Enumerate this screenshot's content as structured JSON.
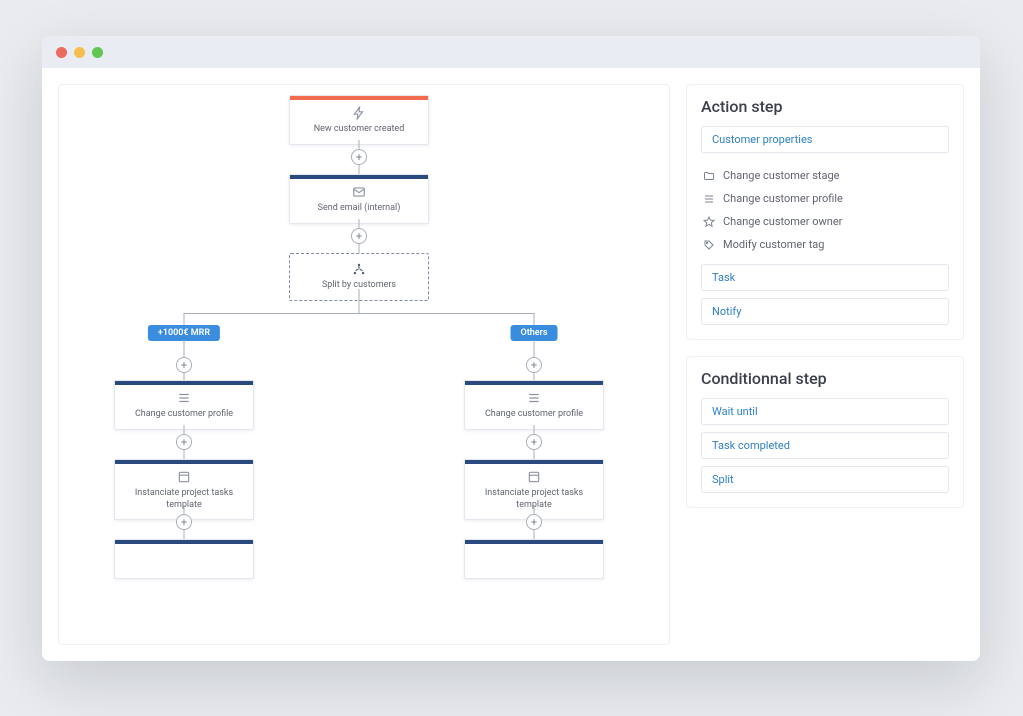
{
  "workflow": {
    "trigger": {
      "label": "New customer created"
    },
    "send_email": {
      "label": "Send email (internal)"
    },
    "split": {
      "label": "Split by customers"
    },
    "branch_a": {
      "badge": "+1000€ MRR",
      "change_profile": {
        "label": "Change customer profile"
      },
      "instantiate": {
        "label": "Instanciate project tasks template"
      }
    },
    "branch_b": {
      "badge": "Others",
      "change_profile": {
        "label": "Change customer profile"
      },
      "instantiate": {
        "label": "Instanciate project tasks template"
      }
    }
  },
  "sidebar": {
    "action": {
      "title": "Action step",
      "customer_properties": "Customer properties",
      "items": [
        {
          "icon": "folder-icon",
          "label": "Change customer stage"
        },
        {
          "icon": "list-icon",
          "label": "Change customer profile"
        },
        {
          "icon": "star-icon",
          "label": "Change customer owner"
        },
        {
          "icon": "tag-icon",
          "label": "Modify customer tag"
        }
      ],
      "task": "Task",
      "notify": "Notify"
    },
    "conditional": {
      "title": "Conditionnal step",
      "wait_until": "Wait until",
      "task_completed": "Task completed",
      "split": "Split"
    }
  }
}
